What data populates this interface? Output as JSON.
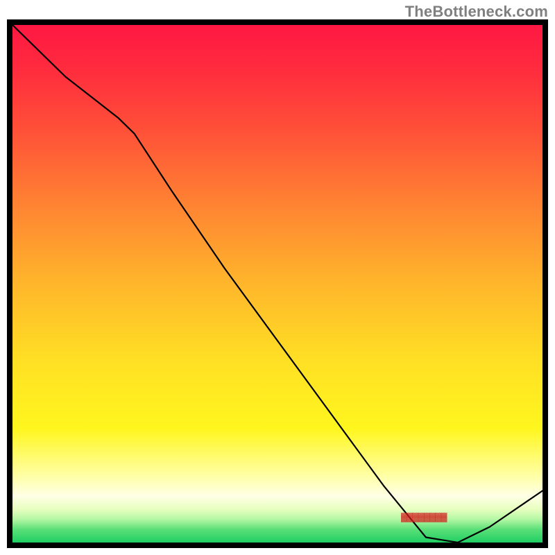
{
  "watermark": "TheBottleneck.com",
  "chart_data": {
    "type": "line",
    "title": "",
    "xlabel": "",
    "ylabel": "",
    "x": [
      0.0,
      0.05,
      0.1,
      0.15,
      0.2,
      0.23,
      0.3,
      0.4,
      0.5,
      0.6,
      0.7,
      0.78,
      0.84,
      0.9,
      1.0
    ],
    "values": [
      1.0,
      0.95,
      0.9,
      0.86,
      0.82,
      0.79,
      0.68,
      0.53,
      0.39,
      0.25,
      0.11,
      0.01,
      0.0,
      0.03,
      0.1
    ],
    "xlim": [
      0,
      1
    ],
    "ylim": [
      0,
      1
    ],
    "gradient_stops": [
      {
        "offset": 0.0,
        "color": "#ff1843"
      },
      {
        "offset": 0.08,
        "color": "#ff2a3e"
      },
      {
        "offset": 0.2,
        "color": "#ff4f38"
      },
      {
        "offset": 0.35,
        "color": "#ff8432"
      },
      {
        "offset": 0.5,
        "color": "#ffb62b"
      },
      {
        "offset": 0.65,
        "color": "#ffe024"
      },
      {
        "offset": 0.78,
        "color": "#fff61e"
      },
      {
        "offset": 0.87,
        "color": "#ffffa4"
      },
      {
        "offset": 0.91,
        "color": "#ffffe6"
      },
      {
        "offset": 0.935,
        "color": "#e8ffc0"
      },
      {
        "offset": 0.955,
        "color": "#b4f7a4"
      },
      {
        "offset": 0.975,
        "color": "#5adf78"
      },
      {
        "offset": 1.0,
        "color": "#1ecf63"
      }
    ]
  },
  "annotations": {
    "valley_marker": "▓▓▓▓▓▓▓▓"
  }
}
